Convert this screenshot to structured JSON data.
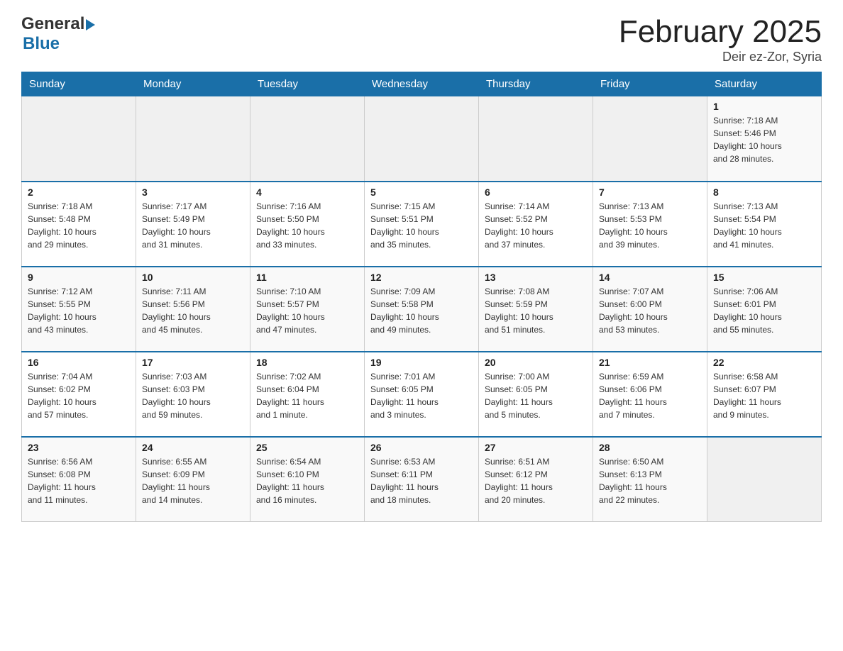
{
  "header": {
    "logo_general": "General",
    "logo_blue": "Blue",
    "title": "February 2025",
    "location": "Deir ez-Zor, Syria"
  },
  "calendar": {
    "days_of_week": [
      "Sunday",
      "Monday",
      "Tuesday",
      "Wednesday",
      "Thursday",
      "Friday",
      "Saturday"
    ],
    "weeks": [
      [
        {
          "day": "",
          "info": ""
        },
        {
          "day": "",
          "info": ""
        },
        {
          "day": "",
          "info": ""
        },
        {
          "day": "",
          "info": ""
        },
        {
          "day": "",
          "info": ""
        },
        {
          "day": "",
          "info": ""
        },
        {
          "day": "1",
          "info": "Sunrise: 7:18 AM\nSunset: 5:46 PM\nDaylight: 10 hours\nand 28 minutes."
        }
      ],
      [
        {
          "day": "2",
          "info": "Sunrise: 7:18 AM\nSunset: 5:48 PM\nDaylight: 10 hours\nand 29 minutes."
        },
        {
          "day": "3",
          "info": "Sunrise: 7:17 AM\nSunset: 5:49 PM\nDaylight: 10 hours\nand 31 minutes."
        },
        {
          "day": "4",
          "info": "Sunrise: 7:16 AM\nSunset: 5:50 PM\nDaylight: 10 hours\nand 33 minutes."
        },
        {
          "day": "5",
          "info": "Sunrise: 7:15 AM\nSunset: 5:51 PM\nDaylight: 10 hours\nand 35 minutes."
        },
        {
          "day": "6",
          "info": "Sunrise: 7:14 AM\nSunset: 5:52 PM\nDaylight: 10 hours\nand 37 minutes."
        },
        {
          "day": "7",
          "info": "Sunrise: 7:13 AM\nSunset: 5:53 PM\nDaylight: 10 hours\nand 39 minutes."
        },
        {
          "day": "8",
          "info": "Sunrise: 7:13 AM\nSunset: 5:54 PM\nDaylight: 10 hours\nand 41 minutes."
        }
      ],
      [
        {
          "day": "9",
          "info": "Sunrise: 7:12 AM\nSunset: 5:55 PM\nDaylight: 10 hours\nand 43 minutes."
        },
        {
          "day": "10",
          "info": "Sunrise: 7:11 AM\nSunset: 5:56 PM\nDaylight: 10 hours\nand 45 minutes."
        },
        {
          "day": "11",
          "info": "Sunrise: 7:10 AM\nSunset: 5:57 PM\nDaylight: 10 hours\nand 47 minutes."
        },
        {
          "day": "12",
          "info": "Sunrise: 7:09 AM\nSunset: 5:58 PM\nDaylight: 10 hours\nand 49 minutes."
        },
        {
          "day": "13",
          "info": "Sunrise: 7:08 AM\nSunset: 5:59 PM\nDaylight: 10 hours\nand 51 minutes."
        },
        {
          "day": "14",
          "info": "Sunrise: 7:07 AM\nSunset: 6:00 PM\nDaylight: 10 hours\nand 53 minutes."
        },
        {
          "day": "15",
          "info": "Sunrise: 7:06 AM\nSunset: 6:01 PM\nDaylight: 10 hours\nand 55 minutes."
        }
      ],
      [
        {
          "day": "16",
          "info": "Sunrise: 7:04 AM\nSunset: 6:02 PM\nDaylight: 10 hours\nand 57 minutes."
        },
        {
          "day": "17",
          "info": "Sunrise: 7:03 AM\nSunset: 6:03 PM\nDaylight: 10 hours\nand 59 minutes."
        },
        {
          "day": "18",
          "info": "Sunrise: 7:02 AM\nSunset: 6:04 PM\nDaylight: 11 hours\nand 1 minute."
        },
        {
          "day": "19",
          "info": "Sunrise: 7:01 AM\nSunset: 6:05 PM\nDaylight: 11 hours\nand 3 minutes."
        },
        {
          "day": "20",
          "info": "Sunrise: 7:00 AM\nSunset: 6:05 PM\nDaylight: 11 hours\nand 5 minutes."
        },
        {
          "day": "21",
          "info": "Sunrise: 6:59 AM\nSunset: 6:06 PM\nDaylight: 11 hours\nand 7 minutes."
        },
        {
          "day": "22",
          "info": "Sunrise: 6:58 AM\nSunset: 6:07 PM\nDaylight: 11 hours\nand 9 minutes."
        }
      ],
      [
        {
          "day": "23",
          "info": "Sunrise: 6:56 AM\nSunset: 6:08 PM\nDaylight: 11 hours\nand 11 minutes."
        },
        {
          "day": "24",
          "info": "Sunrise: 6:55 AM\nSunset: 6:09 PM\nDaylight: 11 hours\nand 14 minutes."
        },
        {
          "day": "25",
          "info": "Sunrise: 6:54 AM\nSunset: 6:10 PM\nDaylight: 11 hours\nand 16 minutes."
        },
        {
          "day": "26",
          "info": "Sunrise: 6:53 AM\nSunset: 6:11 PM\nDaylight: 11 hours\nand 18 minutes."
        },
        {
          "day": "27",
          "info": "Sunrise: 6:51 AM\nSunset: 6:12 PM\nDaylight: 11 hours\nand 20 minutes."
        },
        {
          "day": "28",
          "info": "Sunrise: 6:50 AM\nSunset: 6:13 PM\nDaylight: 11 hours\nand 22 minutes."
        },
        {
          "day": "",
          "info": ""
        }
      ]
    ]
  }
}
